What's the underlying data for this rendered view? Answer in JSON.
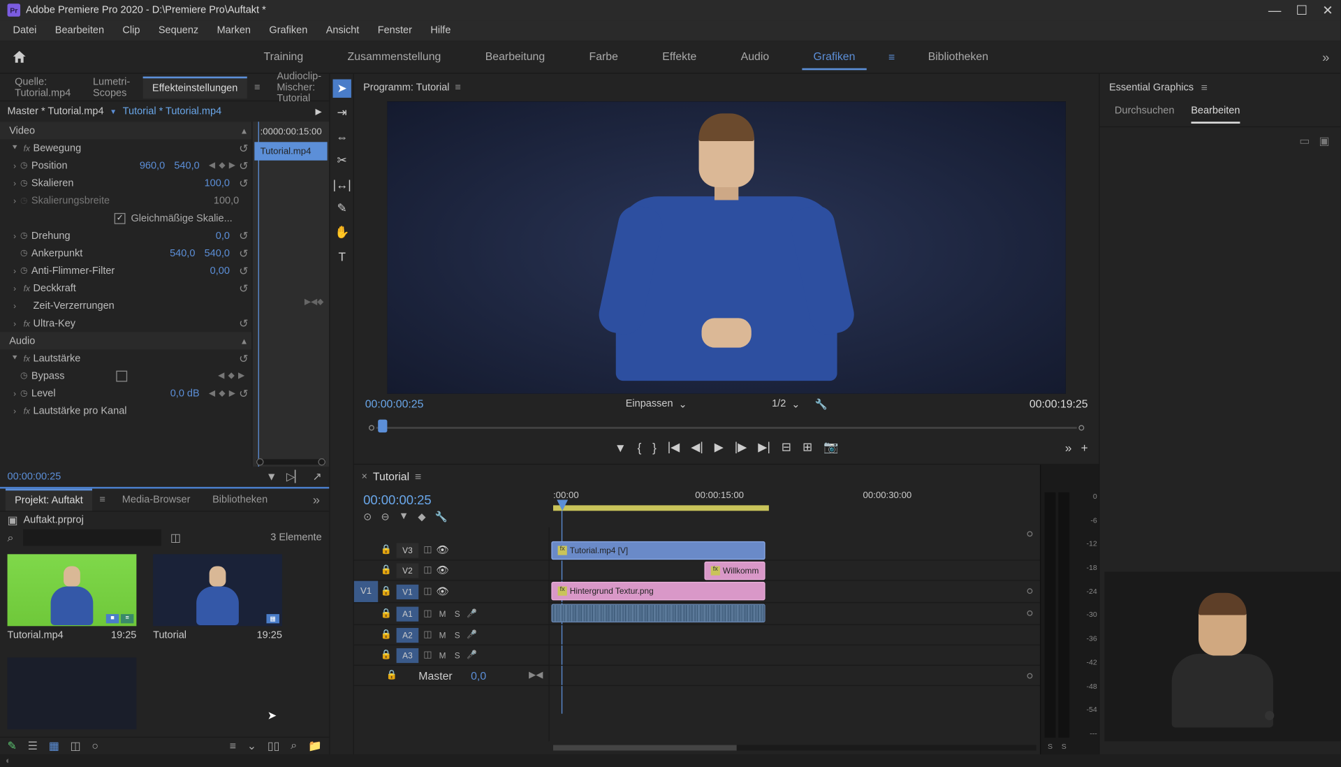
{
  "app": {
    "title": "Adobe Premiere Pro 2020 - D:\\Premiere Pro\\Auftakt *",
    "icon_text": "Pr"
  },
  "menubar": [
    "Datei",
    "Bearbeiten",
    "Clip",
    "Sequenz",
    "Marken",
    "Grafiken",
    "Ansicht",
    "Fenster",
    "Hilfe"
  ],
  "workspaces": {
    "items": [
      "Training",
      "Zusammenstellung",
      "Bearbeitung",
      "Farbe",
      "Effekte",
      "Audio",
      "Grafiken",
      "Bibliotheken"
    ],
    "active": "Grafiken"
  },
  "source_tabs": {
    "items": [
      "Quelle: Tutorial.mp4",
      "Lumetri-Scopes",
      "Effekteinstellungen",
      "Audioclip-Mischer: Tutorial"
    ],
    "active": "Effekteinstellungen"
  },
  "effect_controls": {
    "master": "Master * Tutorial.mp4",
    "child": "Tutorial * Tutorial.mp4",
    "timeline_start": ":00",
    "timeline_mark": "00:00:15:00",
    "clip_label": "Tutorial.mp4",
    "video_section": "Video",
    "bewegung": "Bewegung",
    "position": {
      "label": "Position",
      "x": "960,0",
      "y": "540,0"
    },
    "skalieren": {
      "label": "Skalieren",
      "val": "100,0"
    },
    "skalierungsbreite": {
      "label": "Skalierungsbreite",
      "val": "100,0"
    },
    "gleich": "Gleichmäßige Skalie...",
    "drehung": {
      "label": "Drehung",
      "val": "0,0"
    },
    "ankerpunkt": {
      "label": "Ankerpunkt",
      "x": "540,0",
      "y": "540,0"
    },
    "antiflimmer": {
      "label": "Anti-Flimmer-Filter",
      "val": "0,00"
    },
    "deckkraft": "Deckkraft",
    "zeit": "Zeit-Verzerrungen",
    "ultrakey": "Ultra-Key",
    "audio_section": "Audio",
    "lautstaerke": "Lautstärke",
    "bypass": "Bypass",
    "level": {
      "label": "Level",
      "val": "0,0 dB"
    },
    "prokanal": "Lautstärke pro Kanal",
    "footer_tc": "00:00:00:25"
  },
  "project_tabs": {
    "items": [
      "Projekt: Auftakt",
      "Media-Browser",
      "Bibliotheken"
    ],
    "active": "Projekt: Auftakt"
  },
  "project": {
    "file": "Auftakt.prproj",
    "count": "3 Elemente",
    "bins": [
      {
        "name": "Tutorial.mp4",
        "dur": "19:25"
      },
      {
        "name": "Tutorial",
        "dur": "19:25"
      }
    ]
  },
  "program": {
    "tab": "Programm: Tutorial",
    "tc_left": "00:00:00:25",
    "fit": "Einpassen",
    "zoom": "1/2",
    "tc_right": "00:00:19:25"
  },
  "timeline": {
    "tab": "Tutorial",
    "tc": "00:00:00:25",
    "ruler": [
      ":00:00",
      "00:00:15:00",
      "00:00:30:00"
    ],
    "tracks_v": [
      "V3",
      "V2",
      "V1"
    ],
    "tracks_a": [
      "A1",
      "A2",
      "A3"
    ],
    "source_v": "V1",
    "master": "Master",
    "master_val": "0,0",
    "clips": {
      "v3": "Tutorial.mp4 [V]",
      "v2": "Willkomm",
      "v1": "Hintergrund Textur.png"
    }
  },
  "meters": {
    "scale": [
      "0",
      "-6",
      "-12",
      "-18",
      "-24",
      "-30",
      "-36",
      "-42",
      "-48",
      "-54",
      "---"
    ],
    "solo": "S"
  },
  "essential_graphics": {
    "title": "Essential Graphics",
    "subtabs": [
      "Durchsuchen",
      "Bearbeiten"
    ],
    "active": "Bearbeiten"
  }
}
